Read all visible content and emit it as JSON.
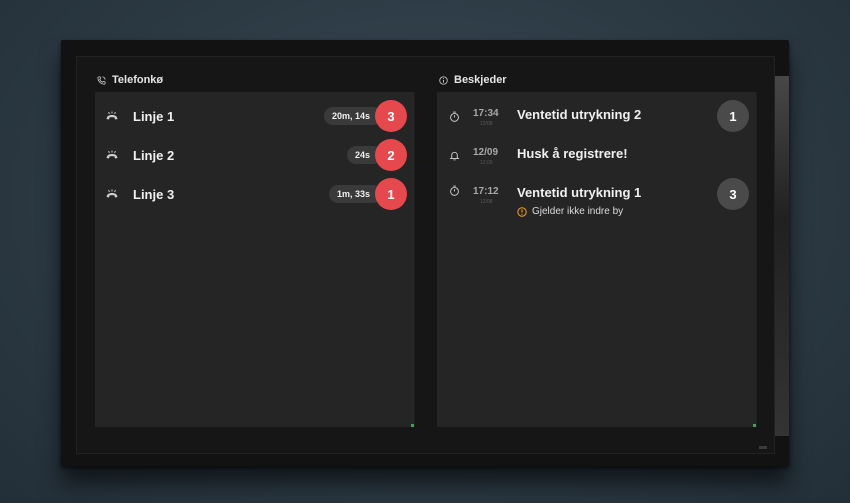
{
  "queue": {
    "title": "Telefonkø",
    "lines": [
      {
        "label": "Linje 1",
        "duration": "20m, 14s",
        "count": "3"
      },
      {
        "label": "Linje 2",
        "duration": "24s",
        "count": "2"
      },
      {
        "label": "Linje 3",
        "duration": "1m, 33s",
        "count": "1"
      }
    ]
  },
  "messages": {
    "title": "Beskjeder",
    "items": [
      {
        "icon": "stopwatch-icon",
        "time": "17:34",
        "sub": "12/08",
        "title": "Ventetid utrykning 2",
        "count": "1",
        "note": ""
      },
      {
        "icon": "bell-icon",
        "time": "12/09",
        "sub": "12:00",
        "title": "Husk å registrere!",
        "count": "",
        "note": ""
      },
      {
        "icon": "stopwatch-icon",
        "time": "17:12",
        "sub": "12/08",
        "title": "Ventetid utrykning 1",
        "count": "3",
        "note": "Gjelder ikke indre by"
      }
    ]
  },
  "colors": {
    "accent_red": "#e5484d",
    "warning": "#f0a020",
    "panel": "#252525",
    "ok_green": "#3aa650"
  }
}
